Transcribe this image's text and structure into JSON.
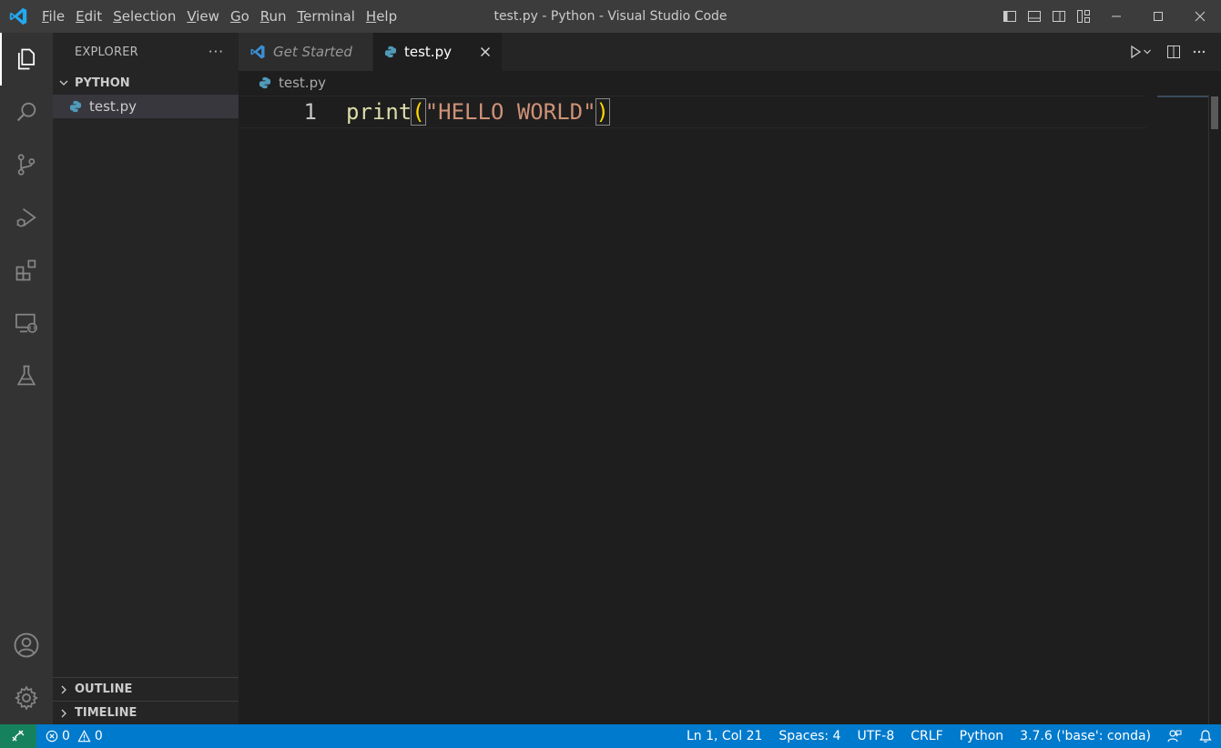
{
  "titlebar": {
    "menu": [
      {
        "label": "File",
        "u": "F",
        "rest": "ile"
      },
      {
        "label": "Edit",
        "u": "E",
        "rest": "dit"
      },
      {
        "label": "Selection",
        "u": "S",
        "rest": "election"
      },
      {
        "label": "View",
        "u": "V",
        "rest": "iew"
      },
      {
        "label": "Go",
        "u": "G",
        "rest": "o"
      },
      {
        "label": "Run",
        "u": "R",
        "rest": "un"
      },
      {
        "label": "Terminal",
        "u": "T",
        "rest": "erminal"
      },
      {
        "label": "Help",
        "u": "H",
        "rest": "elp"
      }
    ],
    "window_title": "test.py - Python - Visual Studio Code"
  },
  "sidebar": {
    "title": "EXPLORER",
    "more": "···",
    "folder": "PYTHON",
    "files": [
      "test.py"
    ],
    "outline": "OUTLINE",
    "timeline": "TIMELINE"
  },
  "tabs": {
    "get_started": "Get Started",
    "active": "test.py"
  },
  "breadcrumb": "test.py",
  "editor": {
    "line_number": "1",
    "tokens": {
      "fn": "print",
      "open": "(",
      "str": "\"HELLO WORLD\"",
      "close": ")"
    }
  },
  "statusbar": {
    "errors": "0",
    "warnings": "0",
    "position": "Ln 1, Col 21",
    "spaces": "Spaces: 4",
    "encoding": "UTF-8",
    "eol": "CRLF",
    "language": "Python",
    "interpreter": "3.7.6 ('base': conda)"
  },
  "colors": {
    "accent": "#007acc",
    "remote": "#16825d",
    "function": "#dcdcaa",
    "string": "#ce9178",
    "bracket": "#ffd700"
  }
}
